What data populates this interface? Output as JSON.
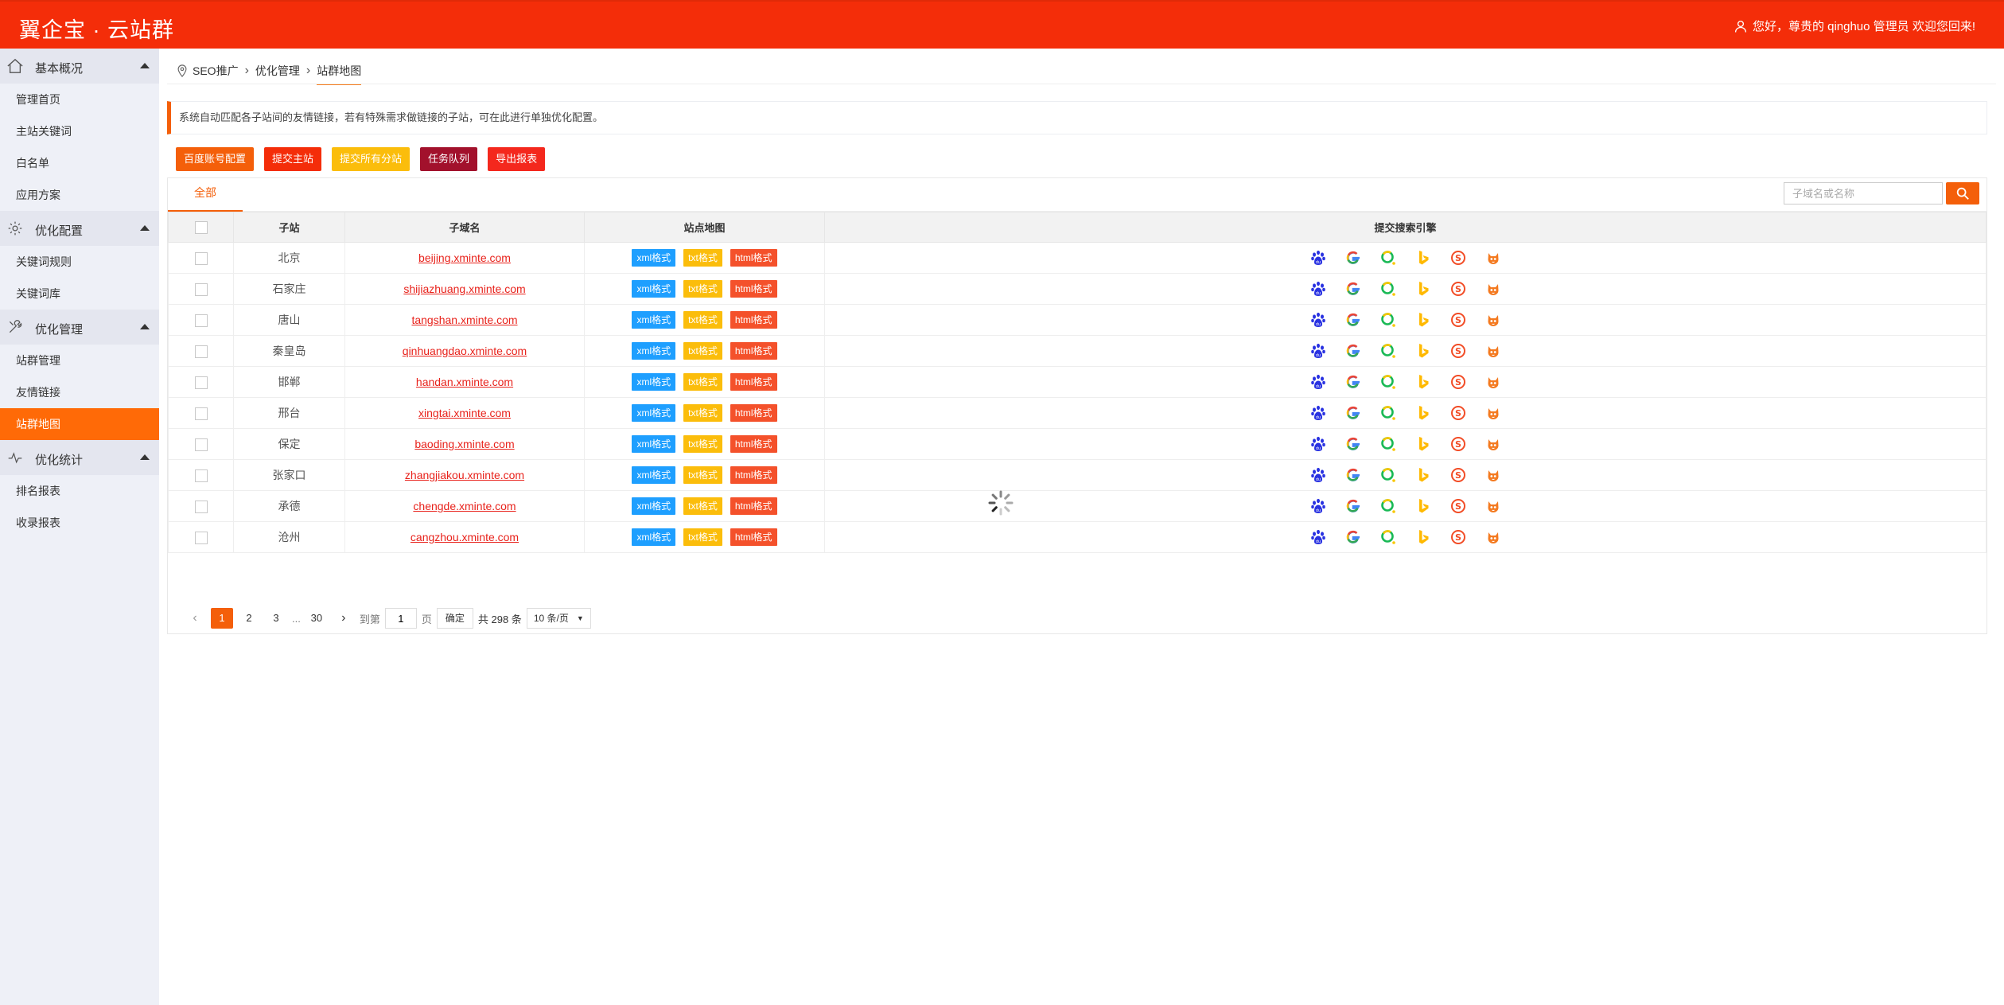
{
  "header": {
    "logo": "翼企宝 · 云站群",
    "welcome": "您好，尊贵的 qinghuo 管理员 欢迎您回来!"
  },
  "sidebar": {
    "groups": [
      {
        "label": "基本概况",
        "items": [
          "管理首页",
          "主站关键词",
          "白名单",
          "应用方案"
        ]
      },
      {
        "label": "优化配置",
        "items": [
          "关键词规则",
          "关键词库"
        ]
      },
      {
        "label": "优化管理",
        "items": [
          "站群管理",
          "友情链接",
          "站群地图"
        ]
      },
      {
        "label": "优化统计",
        "items": [
          "排名报表",
          "收录报表"
        ]
      }
    ],
    "active_item": "站群地图"
  },
  "breadcrumb": [
    "SEO推广",
    "优化管理",
    "站群地图"
  ],
  "notice": "系统自动匹配各子站间的友情链接，若有特殊需求做链接的子站，可在此进行单独优化配置。",
  "buttons": [
    "百度账号配置",
    "提交主站",
    "提交所有分站",
    "任务队列",
    "导出报表"
  ],
  "tab": "全部",
  "search": {
    "placeholder": "子域名或名称"
  },
  "table": {
    "headers": [
      "子站",
      "子域名",
      "站点地图",
      "提交搜索引擎"
    ],
    "tags": [
      "xml格式",
      "txt格式",
      "html格式"
    ],
    "engines": [
      "baidu-icon",
      "google-icon",
      "360-icon",
      "bing-icon",
      "sogou-icon",
      "shenma-icon"
    ],
    "rows": [
      {
        "site": "北京",
        "domain": "beijing.xminte.com"
      },
      {
        "site": "石家庄",
        "domain": "shijiazhuang.xminte.com"
      },
      {
        "site": "唐山",
        "domain": "tangshan.xminte.com"
      },
      {
        "site": "秦皇岛",
        "domain": "qinhuangdao.xminte.com"
      },
      {
        "site": "邯郸",
        "domain": "handan.xminte.com"
      },
      {
        "site": "邢台",
        "domain": "xingtai.xminte.com"
      },
      {
        "site": "保定",
        "domain": "baoding.xminte.com"
      },
      {
        "site": "张家口",
        "domain": "zhangjiakou.xminte.com"
      },
      {
        "site": "承德",
        "domain": "chengde.xminte.com"
      },
      {
        "site": "沧州",
        "domain": "cangzhou.xminte.com"
      }
    ]
  },
  "pager": {
    "pages": [
      "1",
      "2",
      "3",
      "...",
      "30"
    ],
    "goto_label": "到第",
    "goto_value": "1",
    "page_unit": "页",
    "ok": "确定",
    "total": "共 298 条",
    "page_size": "10 条/页"
  },
  "colors": {
    "primary": "#f42d09",
    "accent": "#f45f0a"
  }
}
